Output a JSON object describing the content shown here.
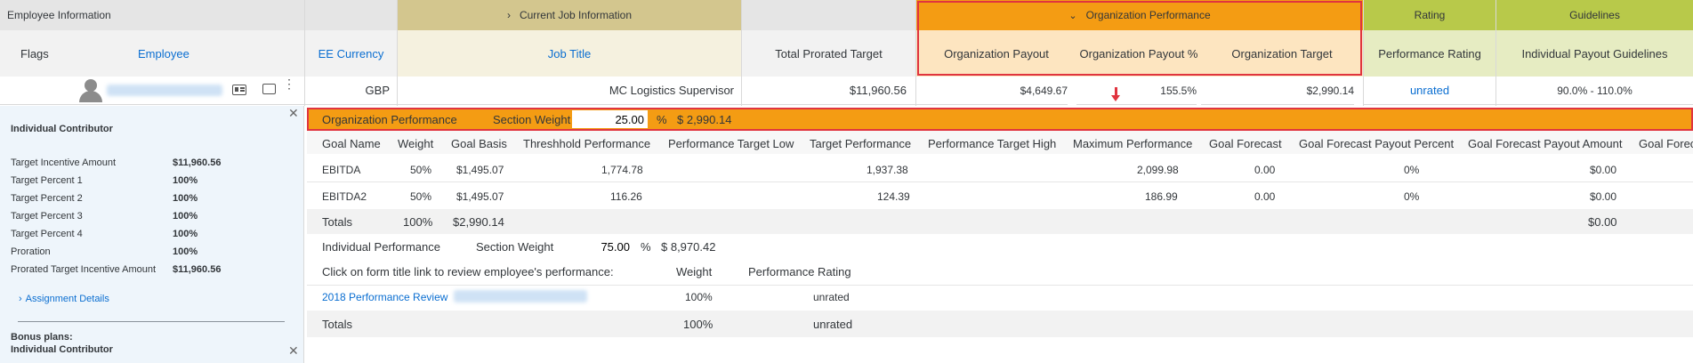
{
  "header": {
    "employee_information": "Employee Information",
    "current_job_information": "Current Job Information",
    "organization_performance": "Organization Performance",
    "rating": "Rating",
    "guidelines": "Guidelines"
  },
  "columns": {
    "flags": "Flags",
    "employee": "Employee",
    "ee_currency": "EE Currency",
    "job_title": "Job Title",
    "total_prorated_target": "Total Prorated Target",
    "organization_payout": "Organization Payout",
    "organization_payout_pct": "Organization Payout %",
    "organization_target": "Organization Target",
    "performance_rating": "Performance Rating",
    "individual_payout_guidelines": "Individual Payout Guidelines"
  },
  "employee_row": {
    "currency": "GBP",
    "job_title": "MC Logistics Supervisor",
    "total_prorated_target": "$11,960.56",
    "organization_payout": "$4,649.67",
    "organization_payout_pct": "155.5%",
    "organization_target": "$2,990.14",
    "performance_rating": "unrated",
    "guidelines": "90.0% - 110.0%"
  },
  "left_panel": {
    "title": "Individual Contributor",
    "rows": [
      {
        "label": "Target Incentive Amount",
        "value": "$11,960.56"
      },
      {
        "label": "Target Percent 1",
        "value": "100%"
      },
      {
        "label": "Target Percent 2",
        "value": "100%"
      },
      {
        "label": "Target Percent 3",
        "value": "100%"
      },
      {
        "label": "Target Percent 4",
        "value": "100%"
      },
      {
        "label": "Proration",
        "value": "100%"
      },
      {
        "label": "Prorated Target Incentive Amount",
        "value": "$11,960.56"
      }
    ],
    "assignment_details": "Assignment Details",
    "bonus_plans_label": "Bonus plans:",
    "bonus_plan_name": "Individual Contributor"
  },
  "org_section": {
    "title": "Organization Performance",
    "section_weight_label": "Section Weight",
    "section_weight_value": "25.00",
    "percent_sign": "%",
    "amount": "$ 2,990.14"
  },
  "goal_table": {
    "headers": [
      "Goal Name",
      "Weight",
      "Goal Basis",
      "Threshhold Performance",
      "Performance Target Low",
      "Target Performance",
      "Performance Target High",
      "Maximum Performance",
      "Goal Forecast",
      "Goal Forecast Payout Percent",
      "Goal Forecast Payout Amount",
      "Goal Forec"
    ],
    "rows": [
      [
        "EBITDA",
        "50%",
        "$1,495.07",
        "1,774.78",
        "",
        "1,937.38",
        "",
        "2,099.98",
        "0.00",
        "0%",
        "$0.00",
        ""
      ],
      [
        "EBITDA2",
        "50%",
        "$1,495.07",
        "116.26",
        "",
        "124.39",
        "",
        "186.99",
        "0.00",
        "0%",
        "$0.00",
        ""
      ]
    ],
    "totals": {
      "label": "Totals",
      "weight": "100%",
      "basis": "$2,990.14",
      "payout_amount": "$0.00"
    }
  },
  "individual_section": {
    "title": "Individual Performance",
    "section_weight_label": "Section Weight",
    "section_weight_value": "75.00",
    "percent_sign": "%",
    "amount": "$ 8,970.42",
    "review_prompt": "Click on form title link to review employee's performance:",
    "weight_header": "Weight",
    "rating_header": "Performance Rating",
    "review_link": "2018 Performance Review",
    "review_weight": "100%",
    "review_rating": "unrated",
    "totals_label": "Totals",
    "totals_weight": "100%",
    "totals_rating": "unrated"
  },
  "colors": {
    "accent_orange": "#f49c13",
    "highlight_red": "#e0343f",
    "link_blue": "#0a6ed1"
  }
}
